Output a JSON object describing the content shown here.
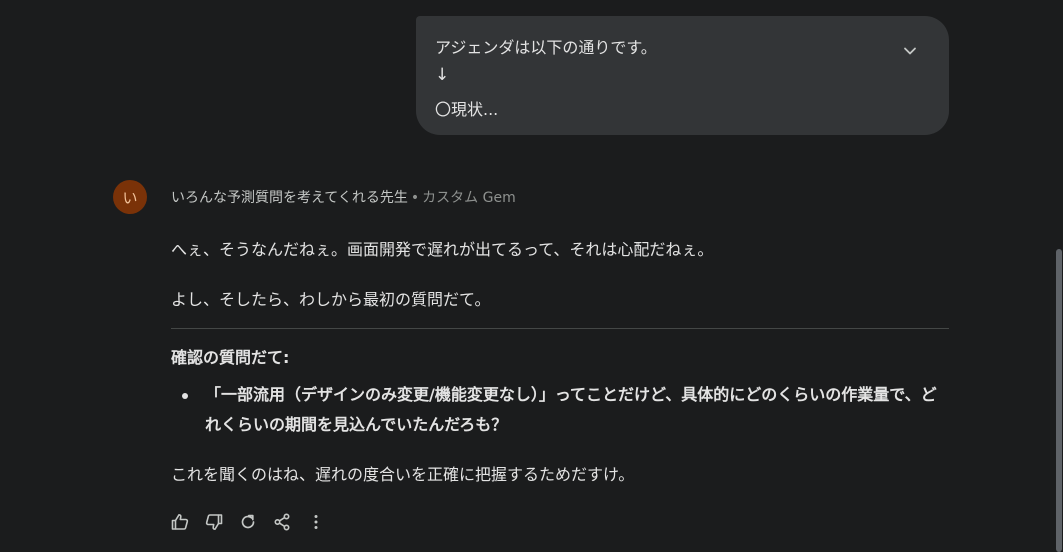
{
  "user_message": {
    "line1": "アジェンダは以下の通りです。",
    "line2": "↓",
    "line3": "〇現状..."
  },
  "response": {
    "avatar_letter": "い",
    "gem_name": "いろんな予測質問を考えてくれる先生",
    "separator": "•",
    "gem_tag": "カスタム Gem",
    "paragraph1": "へぇ、そうなんだねぇ。画面開発で遅れが出てるって、それは心配だねぇ。",
    "paragraph2": "よし、そしたら、わしから最初の質問だて。",
    "section_heading": "確認の質問だて:",
    "bullet": "「一部流用（デザインのみ変更/機能変更なし）」ってことだけど、具体的にどのくらいの作業量で、どれくらいの期間を見込んでいたんだろも？",
    "paragraph3": "これを聞くのはね、遅れの度合いを正確に把握するためだすけ。"
  },
  "actions": {
    "icons": [
      "thumb-up-icon",
      "thumb-down-icon",
      "regenerate-icon",
      "share-icon",
      "more-vert-icon"
    ]
  },
  "colors": {
    "background": "#1b1c1d",
    "bubble": "#333537",
    "avatar": "#7a3208",
    "text": "#e3e3e3",
    "muted": "#8e918f"
  }
}
